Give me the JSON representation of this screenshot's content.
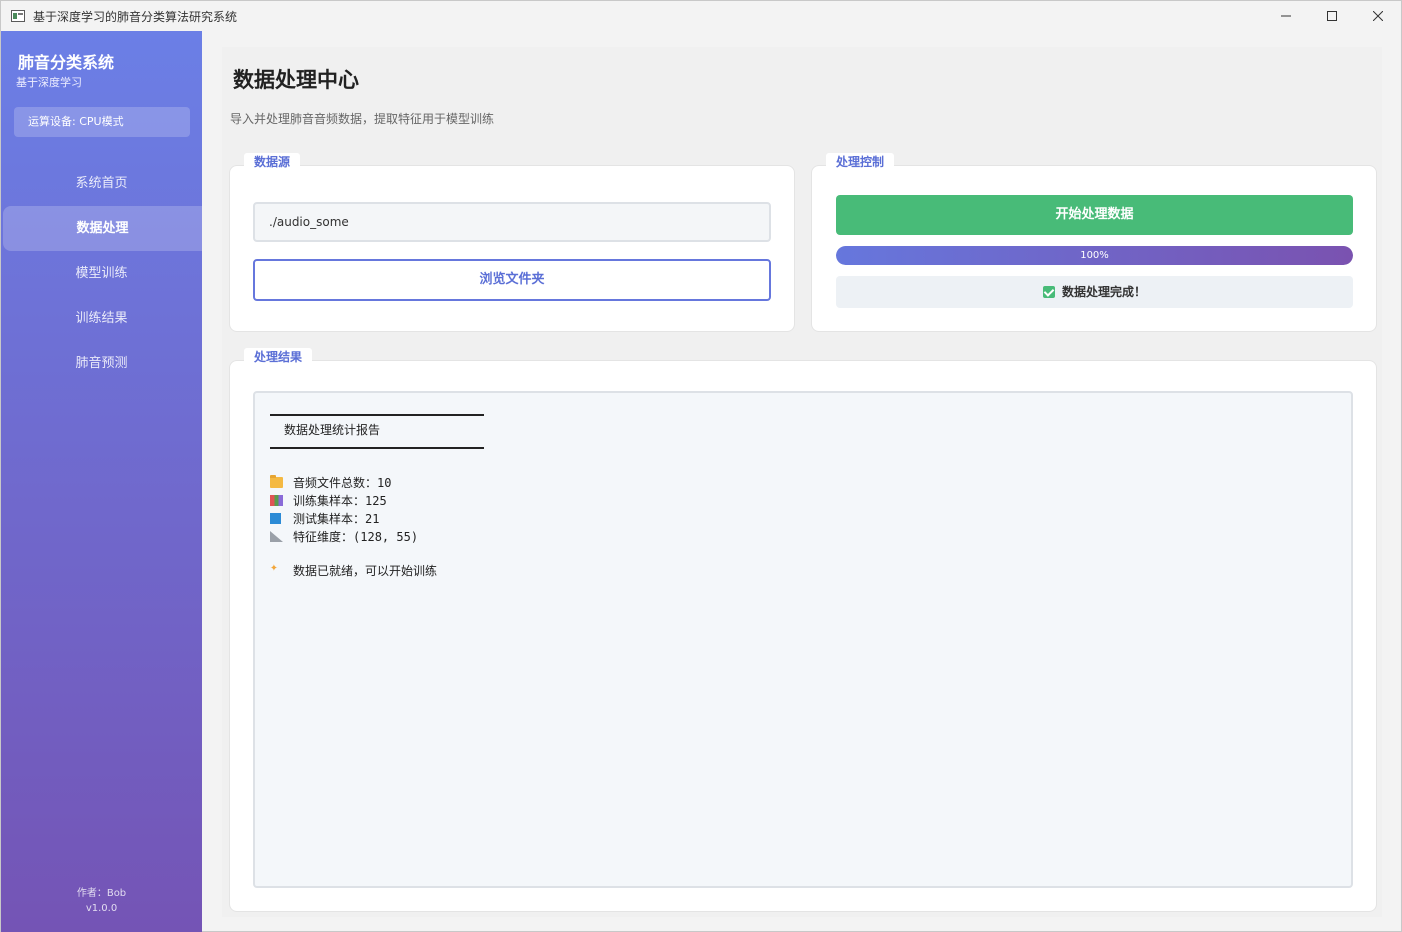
{
  "window": {
    "title": "基于深度学习的肺音分类算法研究系统"
  },
  "sidebar": {
    "brand": "肺音分类系统",
    "brand_sub": "基于深度学习",
    "device": "运算设备: CPU模式",
    "items": [
      {
        "label": "系统首页"
      },
      {
        "label": "数据处理"
      },
      {
        "label": "模型训练"
      },
      {
        "label": "训练结果"
      },
      {
        "label": "肺音预测"
      }
    ],
    "active_index": 1,
    "author": "作者：Bob",
    "version": "v1.0.0"
  },
  "main": {
    "title": "数据处理中心",
    "subtitle": "导入并处理肺音音频数据，提取特征用于模型训练"
  },
  "data_source": {
    "label": "数据源",
    "path_value": "./audio_some",
    "browse_label": "浏览文件夹"
  },
  "control": {
    "label": "处理控制",
    "start_label": "开始处理数据",
    "progress": 1.0,
    "progress_text": "100%",
    "status_text": "数据处理完成！"
  },
  "results": {
    "label": "处理结果",
    "report_title": "数据处理统计报告",
    "lines": {
      "audio_total_label": "音频文件总数：",
      "audio_total_value": "10",
      "train_label": "训练集样本：",
      "train_value": "125",
      "test_label": "测试集样本：",
      "test_value": "21",
      "feature_label": "特征维度：",
      "feature_value": "(128, 55)",
      "ready": "数据已就绪，可以开始训练"
    }
  },
  "colors": {
    "accent": "#5b6fd6",
    "success": "#48bb78",
    "sidebar_top": "#6b7fe6",
    "sidebar_bottom": "#7454b5"
  }
}
